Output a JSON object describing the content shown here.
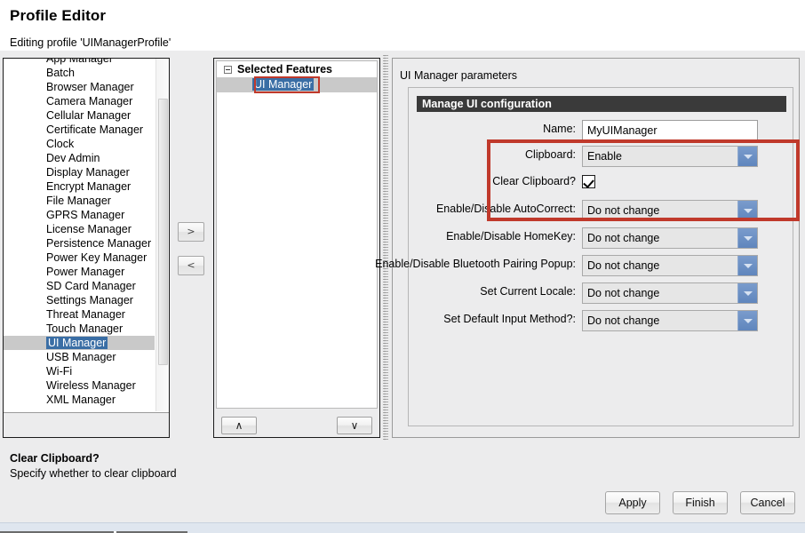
{
  "window": {
    "title": "Profile Editor",
    "subtitle": "Editing profile 'UIManagerProfile'"
  },
  "feature_list": {
    "items": [
      {
        "label": "App Manager",
        "selected": false
      },
      {
        "label": "Batch",
        "selected": false
      },
      {
        "label": "Browser Manager",
        "selected": false
      },
      {
        "label": "Camera Manager",
        "selected": false
      },
      {
        "label": "Cellular Manager",
        "selected": false
      },
      {
        "label": "Certificate Manager",
        "selected": false
      },
      {
        "label": "Clock",
        "selected": false
      },
      {
        "label": "Dev Admin",
        "selected": false
      },
      {
        "label": "Display Manager",
        "selected": false
      },
      {
        "label": "Encrypt Manager",
        "selected": false
      },
      {
        "label": "File Manager",
        "selected": false
      },
      {
        "label": "GPRS Manager",
        "selected": false
      },
      {
        "label": "License Manager",
        "selected": false
      },
      {
        "label": "Persistence Manager",
        "selected": false
      },
      {
        "label": "Power Key Manager",
        "selected": false
      },
      {
        "label": "Power Manager",
        "selected": false
      },
      {
        "label": "SD Card Manager",
        "selected": false
      },
      {
        "label": "Settings Manager",
        "selected": false
      },
      {
        "label": "Threat Manager",
        "selected": false
      },
      {
        "label": "Touch Manager",
        "selected": false
      },
      {
        "label": "UI Manager",
        "selected": true
      },
      {
        "label": "USB Manager",
        "selected": false
      },
      {
        "label": "Wi-Fi",
        "selected": false
      },
      {
        "label": "Wireless Manager",
        "selected": false
      },
      {
        "label": "XML Manager",
        "selected": false
      }
    ]
  },
  "transfer": {
    "add_label": ">",
    "remove_label": "<"
  },
  "selected_features": {
    "root_label": "Selected Features",
    "children": [
      {
        "label": "UI Manager",
        "selected": true,
        "highlighted": true
      }
    ],
    "move_up_label": "∧",
    "move_down_label": "∨"
  },
  "parameters_panel": {
    "caption": "UI Manager parameters",
    "group_title": "Manage UI configuration",
    "fields": [
      {
        "label": "Name:",
        "type": "text",
        "value": "MyUIManager",
        "name": "name-field"
      },
      {
        "label": "Clipboard:",
        "type": "combo",
        "value": "Enable",
        "name": "clipboard-combo"
      },
      {
        "label": "Clear Clipboard?",
        "type": "checkbox",
        "value": "checked",
        "name": "clear-clipboard-checkbox"
      },
      {
        "label": "Enable/Disable AutoCorrect:",
        "type": "combo",
        "value": "Do not change",
        "name": "autocorrect-combo"
      },
      {
        "label": "Enable/Disable HomeKey:",
        "type": "combo",
        "value": "Do not change",
        "name": "homekey-combo"
      },
      {
        "label": "Enable/Disable Bluetooth Pairing Popup:",
        "type": "combo",
        "value": "Do not change",
        "name": "bluetooth-pairing-popup-combo"
      },
      {
        "label": "Set Current Locale:",
        "type": "combo",
        "value": "Do not change",
        "name": "current-locale-combo"
      },
      {
        "label": "Set Default Input Method?:",
        "type": "combo",
        "value": "Do not change",
        "name": "default-input-method-combo"
      }
    ]
  },
  "description": {
    "title": "Clear Clipboard?",
    "text": "Specify whether to clear clipboard"
  },
  "footer": {
    "apply_label": "Apply",
    "finish_label": "Finish",
    "cancel_label": "Cancel"
  },
  "colors": {
    "highlight_red": "#c0392b",
    "selection_blue": "#3a6ea5",
    "group_header_bg": "#3a3a3a",
    "combo_arrow_blue": "#6a8cc0",
    "panel_bg": "#ececed"
  }
}
